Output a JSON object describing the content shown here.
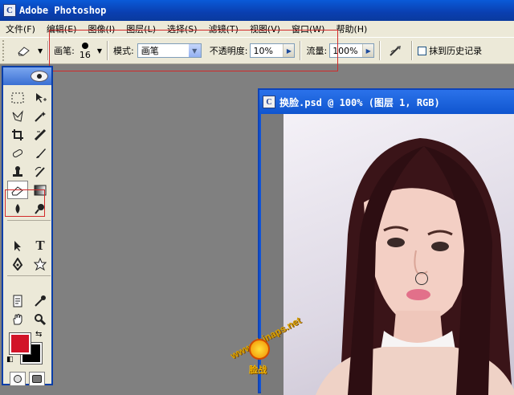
{
  "app": {
    "title": "Adobe Photoshop",
    "icon": "photoshop-app-icon"
  },
  "menu": [
    "文件(F)",
    "编辑(E)",
    "图像(I)",
    "图层(L)",
    "选择(S)",
    "滤镜(T)",
    "视图(V)",
    "窗口(W)",
    "帮助(H)"
  ],
  "options": {
    "tool_icon": "eraser-icon",
    "brush_label": "画笔:",
    "brush_size": "16",
    "mode_label": "模式:",
    "mode_value": "画笔",
    "opacity_label": "不透明度:",
    "opacity_value": "10%",
    "flow_label": "流量:",
    "flow_value": "100%",
    "history_label": "抹到历史记录"
  },
  "toolbox": {
    "active_tool": "eraser",
    "foreground_color": "#d21428",
    "background_color": "#000000"
  },
  "document": {
    "title": "换脸.psd @ 100% (图层 1, RGB)"
  },
  "watermark": {
    "text": "www.chinaps.net",
    "sub": "脸战"
  }
}
